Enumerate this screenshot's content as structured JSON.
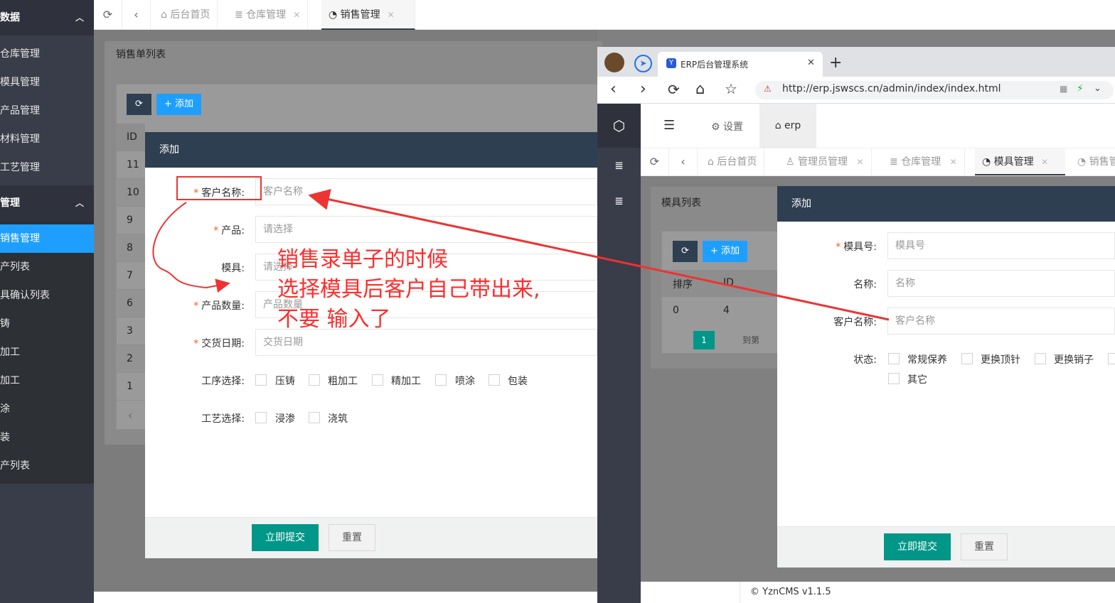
{
  "left_app": {
    "sidebar": {
      "groups": [
        {
          "label": "数据",
          "chevron": "chevron-up-icon"
        },
        {
          "label": "管理",
          "chevron": "chevron-up-icon"
        }
      ],
      "items_group1": [
        "仓库管理",
        "模具管理",
        "产品管理",
        "材料管理",
        "工艺管理"
      ],
      "items_group2": [
        "销售管理",
        "产列表",
        "具确认列表",
        "铸",
        "加工",
        "加工",
        "涂",
        "装",
        "产列表"
      ]
    },
    "tabbar": {
      "tabs": [
        {
          "label": "后台首页",
          "icon": "home-icon",
          "closable": false
        },
        {
          "label": "仓库管理",
          "icon": "database-icon",
          "closable": true
        },
        {
          "label": "销售管理",
          "icon": "palette-icon",
          "closable": true,
          "active": true
        }
      ]
    },
    "list": {
      "title": "销售单列表",
      "add_label": "+ 添加",
      "id_header": "ID",
      "ids": [
        "11",
        "10",
        "9",
        "8",
        "7",
        "6",
        "3",
        "2",
        "1"
      ]
    },
    "modal": {
      "title": "添加",
      "fields": {
        "customer": {
          "label": "客户名称:",
          "placeholder": "客户名称",
          "required": true
        },
        "product": {
          "label": "产品:",
          "placeholder": "请选择",
          "required": true
        },
        "mold": {
          "label": "模具:",
          "placeholder": "请选择",
          "required": false
        },
        "quantity": {
          "label": "产品数量:",
          "placeholder": "产品数量",
          "required": true
        },
        "delivery": {
          "label": "交货日期:",
          "placeholder": "交货日期",
          "required": true
        }
      },
      "process_label": "工序选择:",
      "process_options": [
        "压铸",
        "粗加工",
        "精加工",
        "喷涂",
        "包装"
      ],
      "craft_label": "工艺选择:",
      "craft_options": [
        "浸渗",
        "浇筑"
      ],
      "submit_label": "立即提交",
      "reset_label": "重置"
    }
  },
  "annotation": {
    "line1": "销售录单子的时候",
    "line2": "选择模具后客户自己带出来,",
    "line3": "不要 输入了",
    "color": "#ff2d2d"
  },
  "right_window": {
    "browser": {
      "tab_title": "ERP后台管理系统",
      "new_tab": "+",
      "url": "http://erp.jswscs.cn/admin/index/index.html"
    },
    "header": {
      "settings_label": "设置",
      "erp_label": "erp"
    },
    "tabbar": {
      "tabs": [
        {
          "label": "后台首页",
          "icon": "home-icon",
          "closable": false
        },
        {
          "label": "管理员管理",
          "icon": "user-icon",
          "closable": true
        },
        {
          "label": "仓库管理",
          "icon": "database-icon",
          "closable": true
        },
        {
          "label": "模具管理",
          "icon": "palette-icon",
          "closable": true,
          "active": true
        },
        {
          "label": "销售管",
          "icon": "palette-icon",
          "closable": false
        }
      ]
    },
    "list": {
      "title": "模具列表",
      "add_label": "+ 添加",
      "headers": [
        "排序",
        "ID"
      ],
      "row": [
        "0",
        "4"
      ],
      "page": "1",
      "goto_label": "到第"
    },
    "modal": {
      "title": "添加",
      "fields": {
        "mold_no": {
          "label": "模具号:",
          "placeholder": "模具号",
          "required": true
        },
        "name": {
          "label": "名称:",
          "placeholder": "名称",
          "required": false
        },
        "customer": {
          "label": "客户名称:",
          "placeholder": "客户名称",
          "required": false
        }
      },
      "status_label": "状态:",
      "status_options": [
        "常规保养",
        "更换顶针",
        "更换销子",
        "其它"
      ],
      "submit_label": "立即提交",
      "reset_label": "重置"
    },
    "footer": "© YznCMS v1.1.5"
  }
}
